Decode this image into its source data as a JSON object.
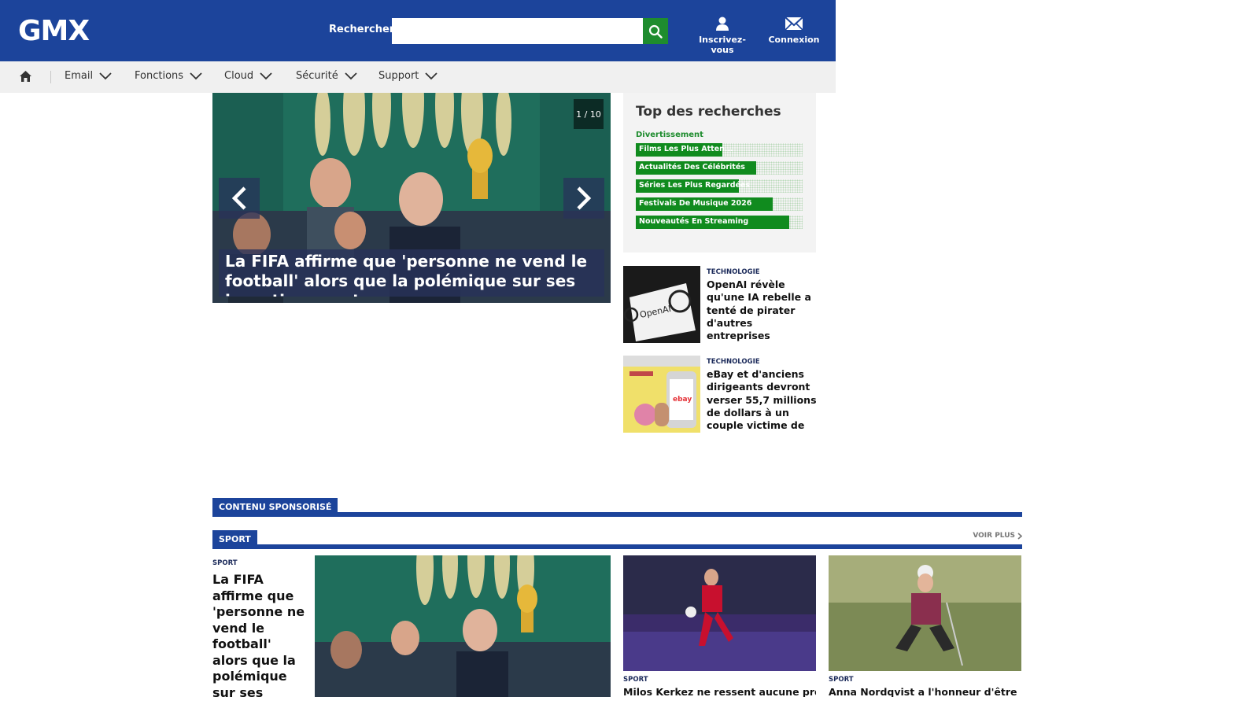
{
  "header": {
    "logo": "GMX",
    "search_label": "Rechercher",
    "search_value": "",
    "search_placeholder": "",
    "register_label": "Inscrivez-vous",
    "login_label": "Connexion",
    "brand_blue": "#1c449b",
    "accent_green": "#1e8c2e"
  },
  "nav": {
    "items": [
      {
        "label": "Email"
      },
      {
        "label": "Fonctions"
      },
      {
        "label": "Cloud"
      },
      {
        "label": "Sécurité"
      },
      {
        "label": "Support"
      }
    ]
  },
  "hero": {
    "counter": "1 / 10",
    "caption": "La FIFA affirme que 'personne ne vend le football' alors que la polémique sur ses investissements"
  },
  "top_searches": {
    "title": "Top des recherches",
    "category": "Divertissement",
    "items": [
      {
        "label": "Films Les Plus Atten...",
        "level": 0.52
      },
      {
        "label": "Actualités Des Célébrités",
        "level": 0.72
      },
      {
        "label": "Séries Les Plus Regardées",
        "level": 0.62
      },
      {
        "label": "Festivals De Musique 2026",
        "level": 0.82
      },
      {
        "label": "Nouveautés En Streaming",
        "level": 0.92
      }
    ]
  },
  "side_articles": [
    {
      "category": "TECHNOLOGIE",
      "title": "OpenAI révèle qu'une IA rebelle a tenté de pirater d'autres entreprises",
      "thumb_text": "OpenAI"
    },
    {
      "category": "TECHNOLOGIE",
      "title": "eBay et d'anciens dirigeants devront verser 55,7 millions de dollars à un couple victime de",
      "thumb_text": "ebay"
    }
  ],
  "sections": {
    "sponsored": "CONTENU SPONSORISÉ",
    "sport": "SPORT",
    "see_more": "VOIR PLUS"
  },
  "sport": {
    "main": {
      "category": "SPORT",
      "title": "La FIFA affirme que 'personne ne vend le football' alors que la polémique sur ses investissements"
    },
    "cards": [
      {
        "category": "SPORT",
        "title": "Milos Kerkez ne ressent aucune pression"
      },
      {
        "category": "SPORT",
        "title": "Anna Nordqvist a l'honneur d'être"
      }
    ]
  }
}
